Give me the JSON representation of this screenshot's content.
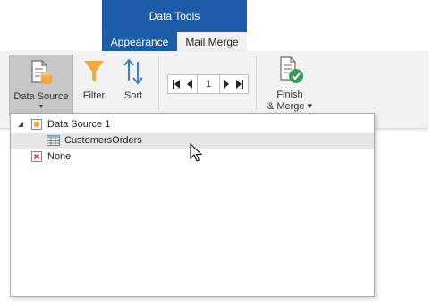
{
  "contextual": {
    "title": "Data Tools",
    "tabs": [
      {
        "label": "Appearance",
        "active": false
      },
      {
        "label": "Mail Merge",
        "active": true
      }
    ],
    "color": "#1d5ca8"
  },
  "ribbon": {
    "data_source": {
      "label": "Data Source",
      "icon": "data-source-icon",
      "caret": "▼"
    },
    "filter": {
      "label": "Filter",
      "icon": "filter-icon"
    },
    "sort": {
      "label": "Sort",
      "icon": "sort-icon"
    },
    "record_nav": {
      "page": "1"
    },
    "finish": {
      "line1": "Finish",
      "line2": "& Merge ▾",
      "icon": "finish-merge-icon"
    }
  },
  "dropdown": {
    "items": [
      {
        "label": "Data Source 1",
        "icon": "database-icon",
        "expanded": true
      },
      {
        "label": "CustomersOrders",
        "icon": "table-icon",
        "selected": true
      },
      {
        "label": "None",
        "icon": "none-x-icon"
      }
    ]
  }
}
